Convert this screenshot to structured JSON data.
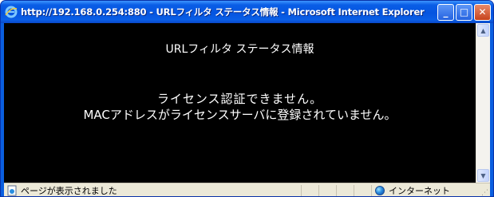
{
  "window": {
    "title": "http://192.168.0.254:880 - URLフィルタ ステータス情報 - Microsoft Internet Explorer",
    "buttons": {
      "minimize": "_",
      "maximize": "□",
      "close": "✕"
    }
  },
  "page": {
    "title": "URLフィルタ ステータス情報",
    "message_line1": "ライセンス認証できません。",
    "message_line2": "MACアドレスがライセンスサーバに登録されていません。"
  },
  "statusbar": {
    "status_text": "ページが表示されました",
    "zone_text": "インターネット"
  },
  "colors": {
    "titlebar": "#0a5fe0",
    "content_bg": "#000000",
    "content_text": "#ffffff",
    "statusbar_bg": "#ece9d8"
  }
}
